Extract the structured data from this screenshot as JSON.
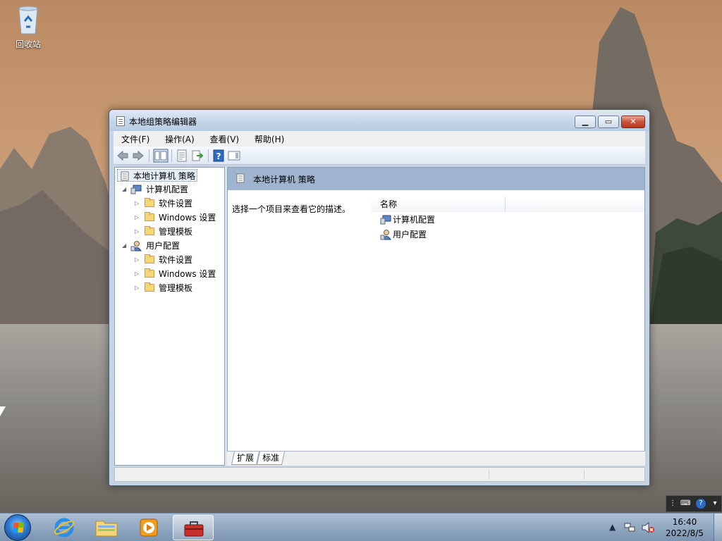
{
  "desktop": {
    "recycle_bin_label": "回收站"
  },
  "window": {
    "title": "本地组策略编辑器",
    "caption_buttons": {
      "minimize": "▁",
      "maximize": "▭",
      "close": "✕"
    },
    "menu": [
      "文件(F)",
      "操作(A)",
      "查看(V)",
      "帮助(H)"
    ],
    "tree": {
      "root": "本地计算机 策略",
      "nodes": [
        {
          "label": "计算机配置",
          "children": [
            "软件设置",
            "Windows 设置",
            "管理模板"
          ]
        },
        {
          "label": "用户配置",
          "children": [
            "软件设置",
            "Windows 设置",
            "管理模板"
          ]
        }
      ]
    },
    "right_pane": {
      "header": "本地计算机 策略",
      "description": "选择一个项目来查看它的描述。",
      "column_header": "名称",
      "items": [
        "计算机配置",
        "用户配置"
      ]
    },
    "tabs": [
      "扩展",
      "标准"
    ]
  },
  "taskbar": {
    "clock_time": "16:40",
    "clock_date": "2022/8/5"
  },
  "colors": {
    "accent": "#9fb4cf",
    "taskbar": "#98b0ca"
  }
}
